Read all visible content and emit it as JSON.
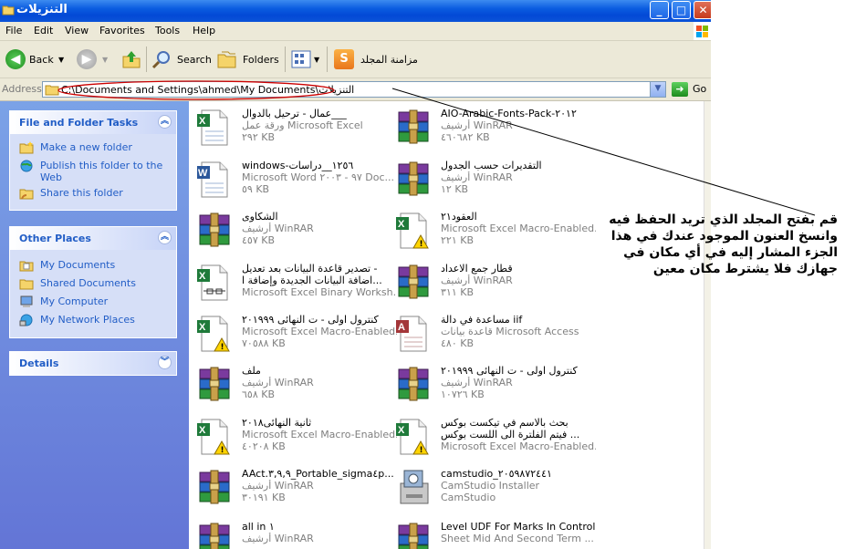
{
  "window": {
    "title": "التنزيلات"
  },
  "menu": [
    "File",
    "Edit",
    "View",
    "Favorites",
    "Tools",
    "Help"
  ],
  "toolbar": {
    "back": "Back",
    "search": "Search",
    "folders": "Folders",
    "sync": "مزامنة المجلد"
  },
  "address": {
    "label": "Address",
    "path": "C:\\Documents and Settings\\ahmed\\My Documents\\التنزيلات",
    "go": "Go"
  },
  "file_tasks": {
    "title": "File and Folder Tasks",
    "items": [
      {
        "label": "Make a new folder",
        "icon": "new-folder-icon"
      },
      {
        "label": "Publish this folder to the Web",
        "icon": "publish-web-icon"
      },
      {
        "label": "Share this folder",
        "icon": "share-folder-icon"
      }
    ]
  },
  "other_places": {
    "title": "Other Places",
    "items": [
      {
        "label": "My Documents",
        "icon": "my-documents-icon"
      },
      {
        "label": "Shared Documents",
        "icon": "shared-documents-icon"
      },
      {
        "label": "My Computer",
        "icon": "my-computer-icon"
      },
      {
        "label": "My Network Places",
        "icon": "network-places-icon"
      }
    ]
  },
  "details": {
    "title": "Details"
  },
  "files": [
    {
      "name": "عمال - ترحيل بالدوال___",
      "type": "ورقة عمل Microsoft Excel",
      "size": "٢٩٢ KB",
      "icon": "excel-icon"
    },
    {
      "name": "AIO-Arabic-Fonts-Pack-٢٠١٢",
      "type": "أرشيف WinRAR",
      "size": "٤٦٠٦٨٢ KB",
      "icon": "winrar-icon"
    },
    {
      "name": "windows-١٢٥٦__دراسات",
      "type": "Microsoft Word ٩٧ - ٢٠٠٣ Doc...",
      "size": "٥٩ KB",
      "icon": "word-icon"
    },
    {
      "name": "التقديرات حسب الجدول",
      "type": "أرشيف WinRAR",
      "size": "١٢ KB",
      "icon": "winrar-icon"
    },
    {
      "name": "الشكاوى",
      "type": "أرشيف WinRAR",
      "size": "٤٥٧ KB",
      "icon": "winrar-icon"
    },
    {
      "name": "العقود٢١",
      "type": "Microsoft Excel Macro-Enabled...",
      "size": "٢٢١ KB",
      "icon": "excel-macro-icon"
    },
    {
      "name": "تصدير قاعدة البيانات بعد تعديل -",
      "name2": "اضافة البيانات الجديدة وإضافة ا...",
      "type": "Microsoft Excel Binary Worksh...",
      "icon": "excel-binary-icon"
    },
    {
      "name": "قطار جمع الاعداد",
      "type": "أرشيف WinRAR",
      "size": "٣١١ KB",
      "icon": "winrar-icon"
    },
    {
      "name": "كنترول اولى - ت النهائى ٢٠١٩٩٩",
      "type": "Microsoft Excel Macro-Enabled...",
      "size": "٧٠٥٨٨ KB",
      "icon": "excel-macro-icon"
    },
    {
      "name": "مساعدة في دالة iif",
      "type": "قاعدة بيانات Microsoft Access",
      "size": "٤٨٠ KB",
      "icon": "access-icon"
    },
    {
      "name": "ملف",
      "type": "أرشيف WinRAR",
      "size": "٦٥٨ KB",
      "icon": "winrar-icon"
    },
    {
      "name": "كنترول اولى - ت النهائى ٢٠١٩٩٩",
      "type": "أرشيف WinRAR",
      "size": "١٠٧٢٦ KB",
      "icon": "winrar-icon"
    },
    {
      "name": "ثانية النهائى٢٠١٨",
      "type": "Microsoft Excel Macro-Enabled...",
      "size": "٤٠٢٠٨ KB",
      "icon": "excel-macro-icon"
    },
    {
      "name": "بحث بالاسم في تيكست بوكس",
      "name2": "فيتم الفلترة الى اللست بوكس ...",
      "type": "Microsoft Excel Macro-Enabled...",
      "icon": "excel-macro-icon"
    },
    {
      "name": "AAct.٣,٩,٩_Portable_sigma٤p...",
      "type": "أرشيف WinRAR",
      "size": "٣٠١٩١ KB",
      "icon": "winrar-icon"
    },
    {
      "name": "camstudio_٢٠٥٩٨٧٢٤٤١",
      "type": "CamStudio Installer",
      "size": "CamStudio",
      "icon": "installer-icon"
    },
    {
      "name": "all in ١",
      "type": "أرشيف WinRAR",
      "icon": "winrar-icon"
    },
    {
      "name": "Level UDF For Marks In Control",
      "type": "Sheet Mid And Second Term ...",
      "icon": "winrar-icon"
    }
  ],
  "annotation": "قم بفتح المجلد الذي تريد الحفظ فيه وانسخ العنون الموجود عندك في هذا الجزء المشار إليه في أي مكان في جهازك فلا يشترط مكان معين",
  "colors": {
    "title_bar": "#0a5ce0",
    "task_pane": "#6d8ee0",
    "panel_header_text": "#215dc6",
    "annotation_outline": "#cc0000"
  }
}
